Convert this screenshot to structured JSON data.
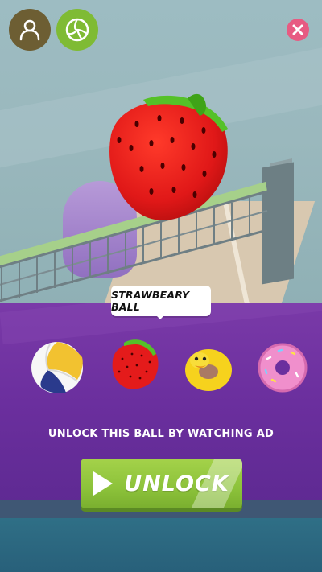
{
  "tooltip": {
    "selected_ball_name": "STRAWBEARY BALL"
  },
  "balls": [
    {
      "name": "volleyball",
      "icon": "volleyball-icon",
      "selected": false
    },
    {
      "name": "strawberry",
      "icon": "strawberry-icon",
      "selected": true
    },
    {
      "name": "duck-ring",
      "icon": "duck-ring-icon",
      "selected": false
    },
    {
      "name": "donut",
      "icon": "donut-icon",
      "selected": false
    }
  ],
  "unlock": {
    "caption": "UNLOCK THIS BALL BY WATCHING AD",
    "button_label": "UNLOCK"
  },
  "top_bar": {
    "profile_icon": "user-icon",
    "balls_icon": "volleyball-icon",
    "close_icon": "close-icon"
  },
  "colors": {
    "panel_purple": "#6b2f9e",
    "unlock_green": "#8cc23a",
    "close_pink": "#e75b82",
    "profile_brown": "#6d5e33",
    "ball_menu_green": "#7fbb34",
    "strawberry_red": "#e51d1d"
  }
}
